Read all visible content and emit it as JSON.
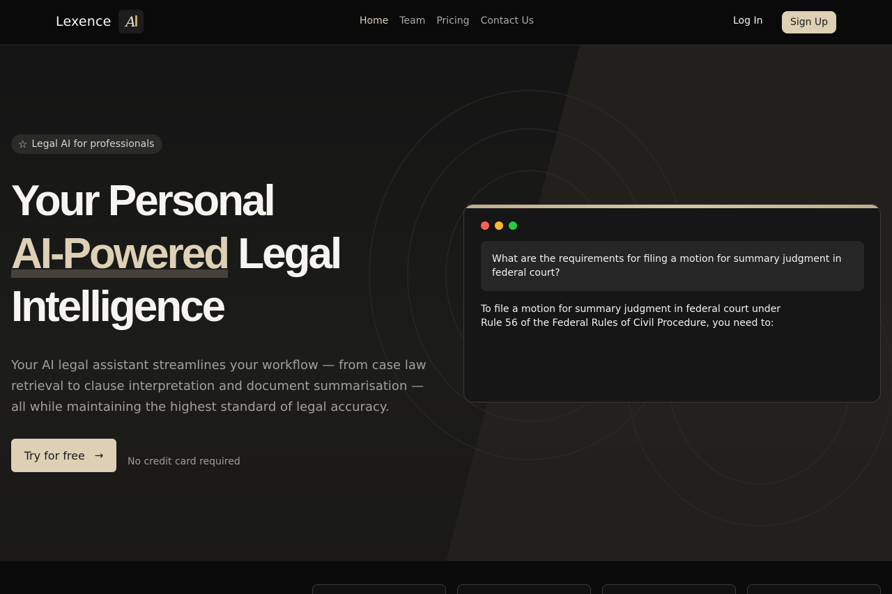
{
  "nav": {
    "brand_name": "Lexence",
    "logo_text": "A",
    "links": [
      {
        "label": "Home",
        "active": true
      },
      {
        "label": "Team",
        "active": false
      },
      {
        "label": "Pricing",
        "active": false
      },
      {
        "label": "Contact Us",
        "active": false
      }
    ],
    "login_label": "Log In",
    "signup_label": "Sign Up"
  },
  "hero": {
    "badge_label": "Legal AI for professionals",
    "headline_line1": "Your Personal",
    "headline_highlight": "AI-Powered",
    "headline_line2_rest": "Legal",
    "headline_line3": "Intelligence",
    "subtext": "Your AI legal assistant streamlines your workflow — from case law retrieval to clause interpretation and document summarisation — all while maintaining the highest standard of legal accuracy.",
    "cta_label": "Try for free",
    "cta_note": "No credit card required"
  },
  "chat": {
    "user_message": "What are the requirements for filing a motion for summary judgment in federal court?",
    "ai_message": "To file a motion for summary judgment in federal court under Rule 56 of the Federal Rules of Civil Procedure, you need to:"
  },
  "colors": {
    "accent": "#ddd0b5",
    "background": "#0b0b0b",
    "dot_red": "#ff5f57",
    "dot_yellow": "#febc2e",
    "dot_green": "#28c840"
  }
}
